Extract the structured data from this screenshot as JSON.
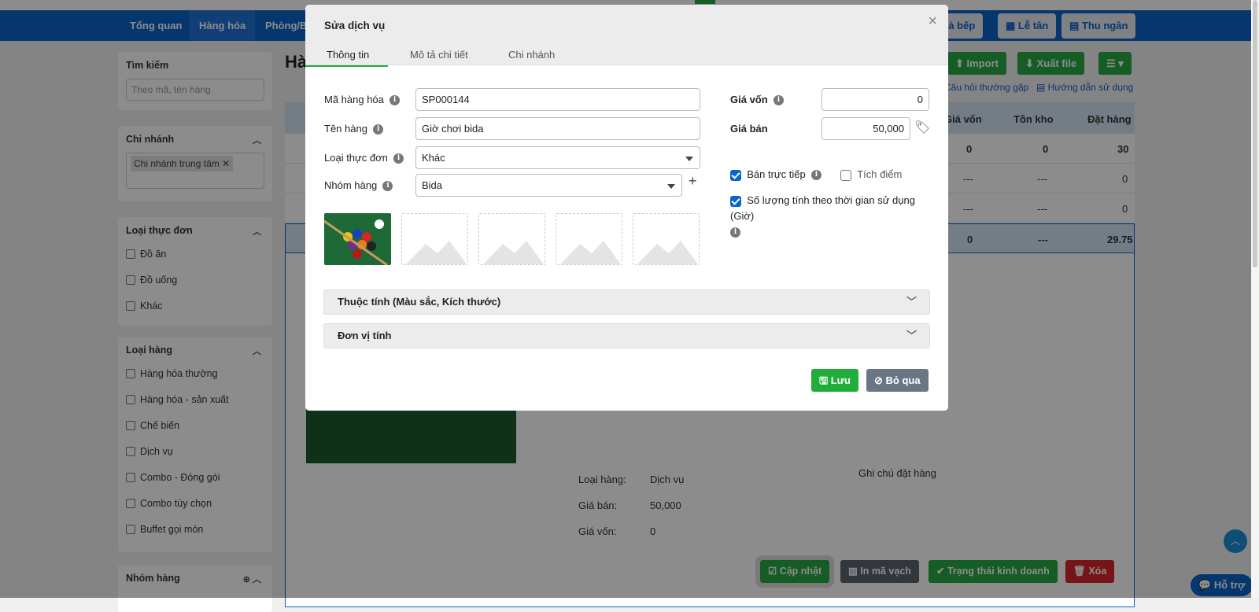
{
  "nav": {
    "items": [
      "Tổng quan",
      "Hàng hóa",
      "Phòng/Bàn"
    ],
    "right": [
      "Nhà bếp",
      "Lễ tân",
      "Thu ngân"
    ]
  },
  "toolbar": {
    "import": "Import",
    "export": "Xuất file",
    "faq": "Câu hỏi thường gặp",
    "guide": "Hướng dẫn sử dụng"
  },
  "page": {
    "title": "Hàng hóa"
  },
  "sidebar": {
    "search": {
      "title": "Tìm kiếm",
      "placeholder": "Theo mã, tên hàng"
    },
    "branch": {
      "title": "Chi nhánh",
      "tag": "Chi nhánh trung tâm"
    },
    "menuType": {
      "title": "Loại thực đơn",
      "items": [
        "Đồ ăn",
        "Đồ uống",
        "Khác"
      ]
    },
    "goodsType": {
      "title": "Loại hàng",
      "items": [
        "Hàng hóa thường",
        "Hàng hóa - sản xuất",
        "Chế biến",
        "Dịch vụ",
        "Combo - Đóng gói",
        "Combo tùy chọn",
        "Buffet gọi món"
      ]
    },
    "group": {
      "title": "Nhóm hàng"
    }
  },
  "table": {
    "headers": [
      "Giá vốn",
      "Tồn kho",
      "Đặt hàng"
    ],
    "rows": [
      [
        "0",
        "0",
        "30"
      ],
      [
        "---",
        "---",
        "0"
      ],
      [
        "---",
        "---",
        "0"
      ],
      [
        "0",
        "---",
        "29.75"
      ]
    ]
  },
  "detail": {
    "labels": [
      "Loại hàng:",
      "Giá bán:",
      "Giá vốn:"
    ],
    "values": [
      "Dịch vụ",
      "50,000",
      "0"
    ],
    "note": "Ghi chú đặt hàng"
  },
  "footer": {
    "update": "Cập nhật",
    "barcode": "In mã vạch",
    "status": "Trạng thái kinh doanh",
    "delete": "Xóa",
    "help": "Hỗ trợ"
  },
  "modal": {
    "title": "Sửa dịch vụ",
    "tabs": [
      "Thông tin",
      "Mô tả chi tiết",
      "Chi nhánh"
    ],
    "fields": {
      "code": {
        "label": "Mã hàng hóa",
        "value": "SP000144"
      },
      "name": {
        "label": "Tên hàng",
        "value": "Giờ chơi bida"
      },
      "menuType": {
        "label": "Loại thực đơn",
        "value": "Khác"
      },
      "group": {
        "label": "Nhóm hàng",
        "value": "Bida"
      },
      "cost": {
        "label": "Giá vốn",
        "value": "0"
      },
      "price": {
        "label": "Giá bán",
        "value": "50,000"
      }
    },
    "checks": {
      "direct": "Bán trực tiếp",
      "points": "Tích điểm",
      "timeQty": "Số lượng tính theo thời gian sử dụng (Giờ)"
    },
    "sections": [
      "Thuộc tính (Màu sắc, Kích thước)",
      "Đơn vị tính"
    ],
    "save": "Lưu",
    "cancel": "Bỏ qua"
  }
}
